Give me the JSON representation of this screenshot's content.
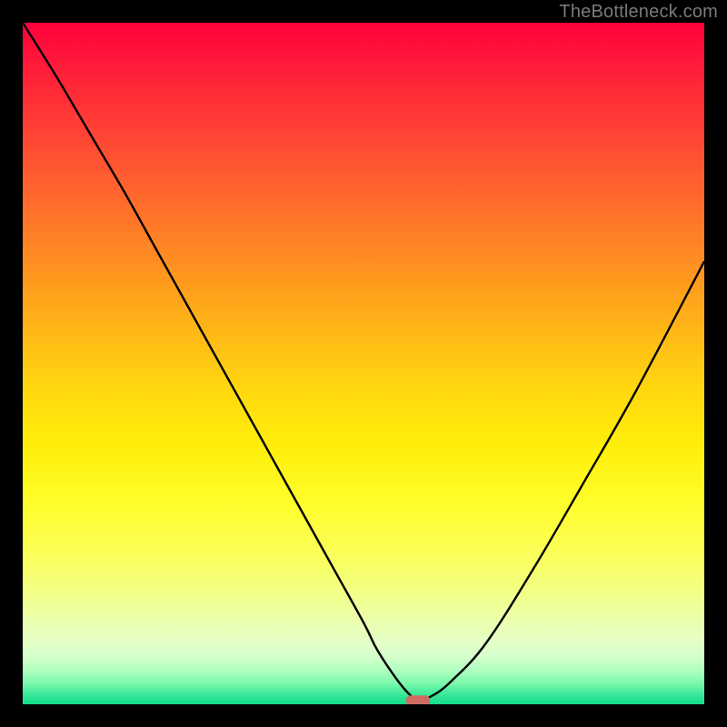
{
  "watermark": "TheBottleneck.com",
  "chart_data": {
    "type": "line",
    "title": "",
    "xlabel": "",
    "ylabel": "",
    "xlim": [
      0,
      100
    ],
    "ylim": [
      0,
      100
    ],
    "grid": false,
    "legend": false,
    "series": [
      {
        "name": "bottleneck-curve",
        "x": [
          0,
          5,
          10,
          15,
          20,
          25,
          30,
          35,
          40,
          45,
          50,
          52,
          55,
          57,
          58,
          60,
          63,
          68,
          75,
          82,
          90,
          100
        ],
        "y": [
          100,
          92,
          83.5,
          75,
          66,
          57,
          48,
          39,
          30,
          21,
          12,
          8,
          3.5,
          1.2,
          0.7,
          1.2,
          3.5,
          9,
          20,
          32,
          46,
          65
        ]
      }
    ],
    "markers": [
      {
        "name": "optimal-marker",
        "x": 58,
        "y": 0.5,
        "color": "#cf6b61",
        "shape": "pill"
      }
    ],
    "background_gradient": {
      "from": "#ff003c",
      "to": "#14db8c",
      "direction": "top-to-bottom"
    },
    "colors": {
      "curve": "#000000",
      "marker": "#cf6b61",
      "frame": "#000000"
    }
  }
}
